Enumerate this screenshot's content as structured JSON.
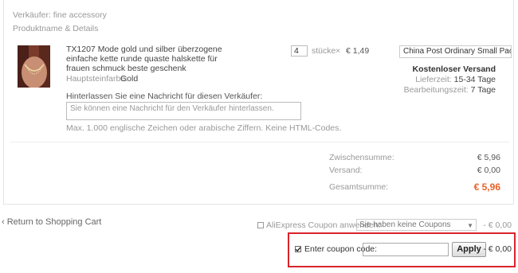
{
  "seller": {
    "label": "Verkäufer: fine accessory"
  },
  "table": {
    "header": "Produktname & Details"
  },
  "product": {
    "title": "TX1207 Mode gold und silber überzogene einfache kette runde quaste halskette für frauen schmuck beste geschenk",
    "color_label": "Hauptsteinfarbe:",
    "color_value": "Gold",
    "quantity": "4",
    "quantity_unit": "stücke",
    "times": "×",
    "unit_price": "€ 1,49"
  },
  "shipping": {
    "method": "China Post Ordinary Small Packet Plus",
    "free_label": "Kostenloser Versand",
    "delivery_label": "Lieferzeit:",
    "delivery_value": "15-34 Tage",
    "processing_label": "Bearbeitungszeit:",
    "processing_value": "7 Tage"
  },
  "message": {
    "label": "Hinterlassen Sie eine Nachricht für diesen Verkäufer:",
    "placeholder": "Sie können eine Nachricht für den Verkäufer hinterlassen.",
    "hint": "Max. 1.000 englische Zeichen oder arabische Ziffern. Keine HTML-Codes."
  },
  "summary": {
    "subtotal_label": "Zwischensumme:",
    "subtotal_value": "€ 5,96",
    "shipping_label": "Versand:",
    "shipping_value": "€ 0,00",
    "total_label": "Gesamtsumme:",
    "total_value": "€ 5,96",
    "accent_color": "#e9612a"
  },
  "nav": {
    "return_link": "‹ Return to Shopping Cart"
  },
  "coupon": {
    "aliexpress_label": "AliExpress Coupon anwenden:",
    "aliexpress_select": "Sie haben keine Coupons",
    "aliexpress_discount": "- € 0,00",
    "code_label": "Enter coupon code:",
    "code_value": "",
    "apply_label": "Apply",
    "code_discount": "- € 0,00",
    "code_checked": true,
    "highlight_color": "#d9242b"
  }
}
